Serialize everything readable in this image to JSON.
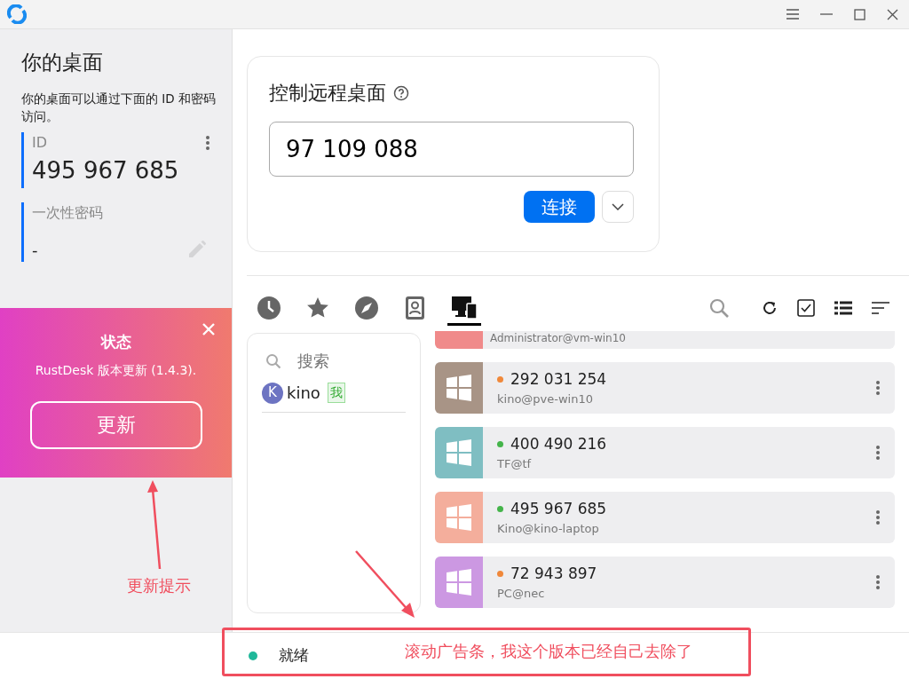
{
  "sidebar": {
    "title": "你的桌面",
    "description": "你的桌面可以通过下面的 ID 和密码访问。",
    "id_label": "ID",
    "id_value": "495 967 685",
    "password_label": "一次性密码",
    "password_value": "-"
  },
  "update_panel": {
    "title": "状态",
    "message": "RustDesk 版本更新 (1.4.3).",
    "button": "更新"
  },
  "control": {
    "title": "控制远程桌面",
    "id_input": "97 109 088",
    "connect_button": "连接"
  },
  "tabs": [
    {
      "kind": "recent",
      "selected": false
    },
    {
      "kind": "favorites",
      "selected": false
    },
    {
      "kind": "discovered",
      "selected": false
    },
    {
      "kind": "address-book",
      "selected": false
    },
    {
      "kind": "group",
      "selected": true
    }
  ],
  "search": {
    "placeholder": "搜索"
  },
  "users": [
    {
      "initial": "K",
      "name": "kino",
      "badge": "我"
    }
  ],
  "peers": [
    {
      "kind": "partial",
      "subtitle": "Administrator@vm-win10",
      "color": "#f08a8a"
    },
    {
      "kind": "full",
      "id": "292 031 254",
      "subtitle": "kino@pve-win10",
      "online": false,
      "color": "#a89486"
    },
    {
      "kind": "full",
      "id": "400 490 216",
      "subtitle": "TF@tf",
      "online": true,
      "color": "#7fbec2"
    },
    {
      "kind": "full",
      "id": "495 967 685",
      "subtitle": "Kino@kino-laptop",
      "online": true,
      "color": "#f4ae9c"
    },
    {
      "kind": "full",
      "id": "72 943 897",
      "subtitle": "PC@nec",
      "online": false,
      "color": "#cc98e2"
    }
  ],
  "status_bar": {
    "online": true,
    "text": "就绪"
  },
  "annotations": [
    {
      "kind": "arrow-label",
      "text": "更新提示"
    },
    {
      "kind": "box",
      "text": "滚动广告条，我这个版本已经自己去除了"
    }
  ]
}
